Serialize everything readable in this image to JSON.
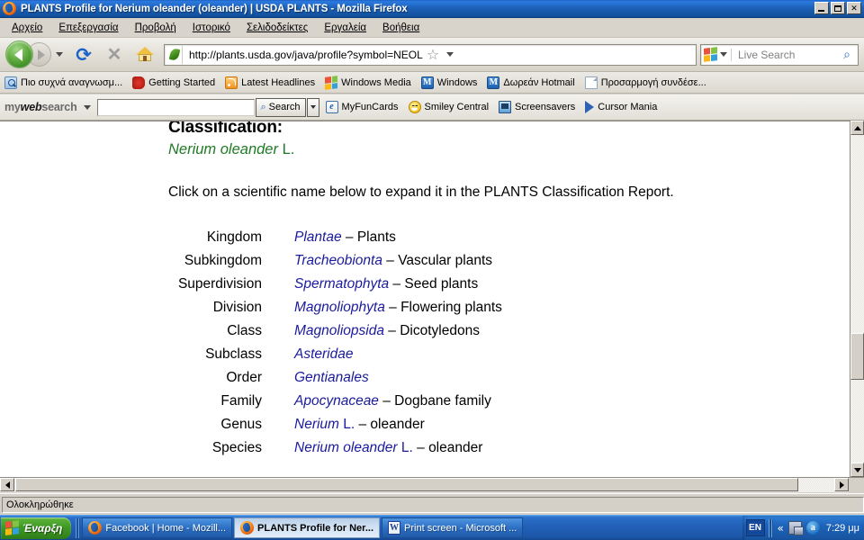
{
  "window": {
    "title": "PLANTS Profile for Nerium oleander (oleander) | USDA PLANTS - Mozilla Firefox",
    "app_icon": "firefox-icon",
    "minimize_label": "",
    "restore_label": "",
    "close_label": "✕"
  },
  "menubar": {
    "items": [
      {
        "label": "Αρχείο"
      },
      {
        "label": "Επεξεργασία"
      },
      {
        "label": "Προβολή"
      },
      {
        "label": "Ιστορικό"
      },
      {
        "label": "Σελιδοδείκτες"
      },
      {
        "label": "Εργαλεία"
      },
      {
        "label": "Βοήθεια"
      }
    ]
  },
  "navbar": {
    "back_icon": "back-arrow-icon",
    "forward_icon": "forward-arrow-icon",
    "reload_icon": "⟳",
    "stop_icon": "✕",
    "home_icon": "home-icon",
    "url_value": "http://plants.usda.gov/java/profile?symbol=NEOL",
    "url_placeholder": "",
    "favicon": "green-leaf-icon",
    "bookmark_star_icon": "☆",
    "search_placeholder": "Live Search",
    "search_value": "",
    "search_engine_icon": "windows-live-icon",
    "search_go_icon": "⌕"
  },
  "bookmarks": {
    "items": [
      {
        "label": "Πιο συχνά αναγνωσμ...",
        "icon": "folder-search-icon"
      },
      {
        "label": "Getting Started",
        "icon": "dinosaur-icon"
      },
      {
        "label": "Latest Headlines",
        "icon": "rss-feed-icon"
      },
      {
        "label": "Windows Media",
        "icon": "windows-logo-icon"
      },
      {
        "label": "Windows",
        "icon": "msn-m-icon"
      },
      {
        "label": "Δωρεάν Hotmail",
        "icon": "msn-m-icon"
      },
      {
        "label": "Προσαρμογή συνδέσε...",
        "icon": "page-icon"
      }
    ]
  },
  "mywebsearch": {
    "logo_my": "my",
    "logo_web": "web",
    "logo_search": "search",
    "input_value": "",
    "input_placeholder": "",
    "search_button_label": "Search",
    "search_button_icon": "⌕",
    "links": [
      {
        "label": "MyFunCards",
        "icon": "e-card-icon"
      },
      {
        "label": "Smiley Central",
        "icon": "smiley-icon"
      },
      {
        "label": "Screensavers",
        "icon": "monitor-icon"
      },
      {
        "label": "Cursor Mania",
        "icon": "cursor-arrow-icon"
      }
    ]
  },
  "page": {
    "heading": "Classification:",
    "binomial_italic": "Nerium oleander",
    "binomial_authority": " L.",
    "instructions": "Click on a scientific name below to expand it in the PLANTS Classification Report.",
    "colors": {
      "link": "#1a1a9c",
      "binomial": "#1f7a25",
      "text": "#000000"
    },
    "taxonomy": [
      {
        "rank": "Kingdom",
        "name": "Plantae",
        "authority": "",
        "dash": " – ",
        "common": "Plants"
      },
      {
        "rank": "Subkingdom",
        "name": "Tracheobionta",
        "authority": "",
        "dash": " – ",
        "common": "Vascular plants"
      },
      {
        "rank": "Superdivision",
        "name": "Spermatophyta",
        "authority": "",
        "dash": " – ",
        "common": "Seed plants"
      },
      {
        "rank": "Division",
        "name": "Magnoliophyta",
        "authority": "",
        "dash": " – ",
        "common": "Flowering plants"
      },
      {
        "rank": "Class",
        "name": "Magnoliopsida",
        "authority": "",
        "dash": " – ",
        "common": "Dicotyledons"
      },
      {
        "rank": "Subclass",
        "name": "Asteridae",
        "authority": "",
        "dash": "",
        "common": ""
      },
      {
        "rank": "Order",
        "name": "Gentianales",
        "authority": "",
        "dash": "",
        "common": ""
      },
      {
        "rank": "Family",
        "name": "Apocynaceae",
        "authority": "",
        "dash": " – ",
        "common": "Dogbane family"
      },
      {
        "rank": "Genus",
        "name": "Nerium",
        "authority": " L.",
        "dash": " – ",
        "common": "oleander"
      },
      {
        "rank": "Species",
        "name": "Nerium oleander",
        "authority": " L.",
        "dash": " – ",
        "common": "oleander"
      }
    ]
  },
  "scrollbars": {
    "v_up_icon": "scroll-up-arrow-icon",
    "v_down_icon": "scroll-down-arrow-icon",
    "h_left_icon": "scroll-left-arrow-icon",
    "h_right_icon": "scroll-right-arrow-icon"
  },
  "statusbar": {
    "text": "Ολοκληρώθηκε"
  },
  "taskbar": {
    "start_label": "Έναρξη",
    "start_icon": "windows-flag-icon",
    "tasks": [
      {
        "label": "Facebook | Home - Mozill...",
        "icon": "firefox-icon",
        "active": false
      },
      {
        "label": "PLANTS Profile for Ner...",
        "icon": "firefox-icon",
        "active": true
      },
      {
        "label": "Print screen - Microsoft ...",
        "icon": "word-icon",
        "active": false
      }
    ],
    "tray": {
      "language": "EN",
      "chevron": "«",
      "icons": [
        {
          "name": "network-icon"
        },
        {
          "name": "adobe-icon",
          "glyph": "a"
        }
      ],
      "clock": "7:29 μμ"
    }
  }
}
